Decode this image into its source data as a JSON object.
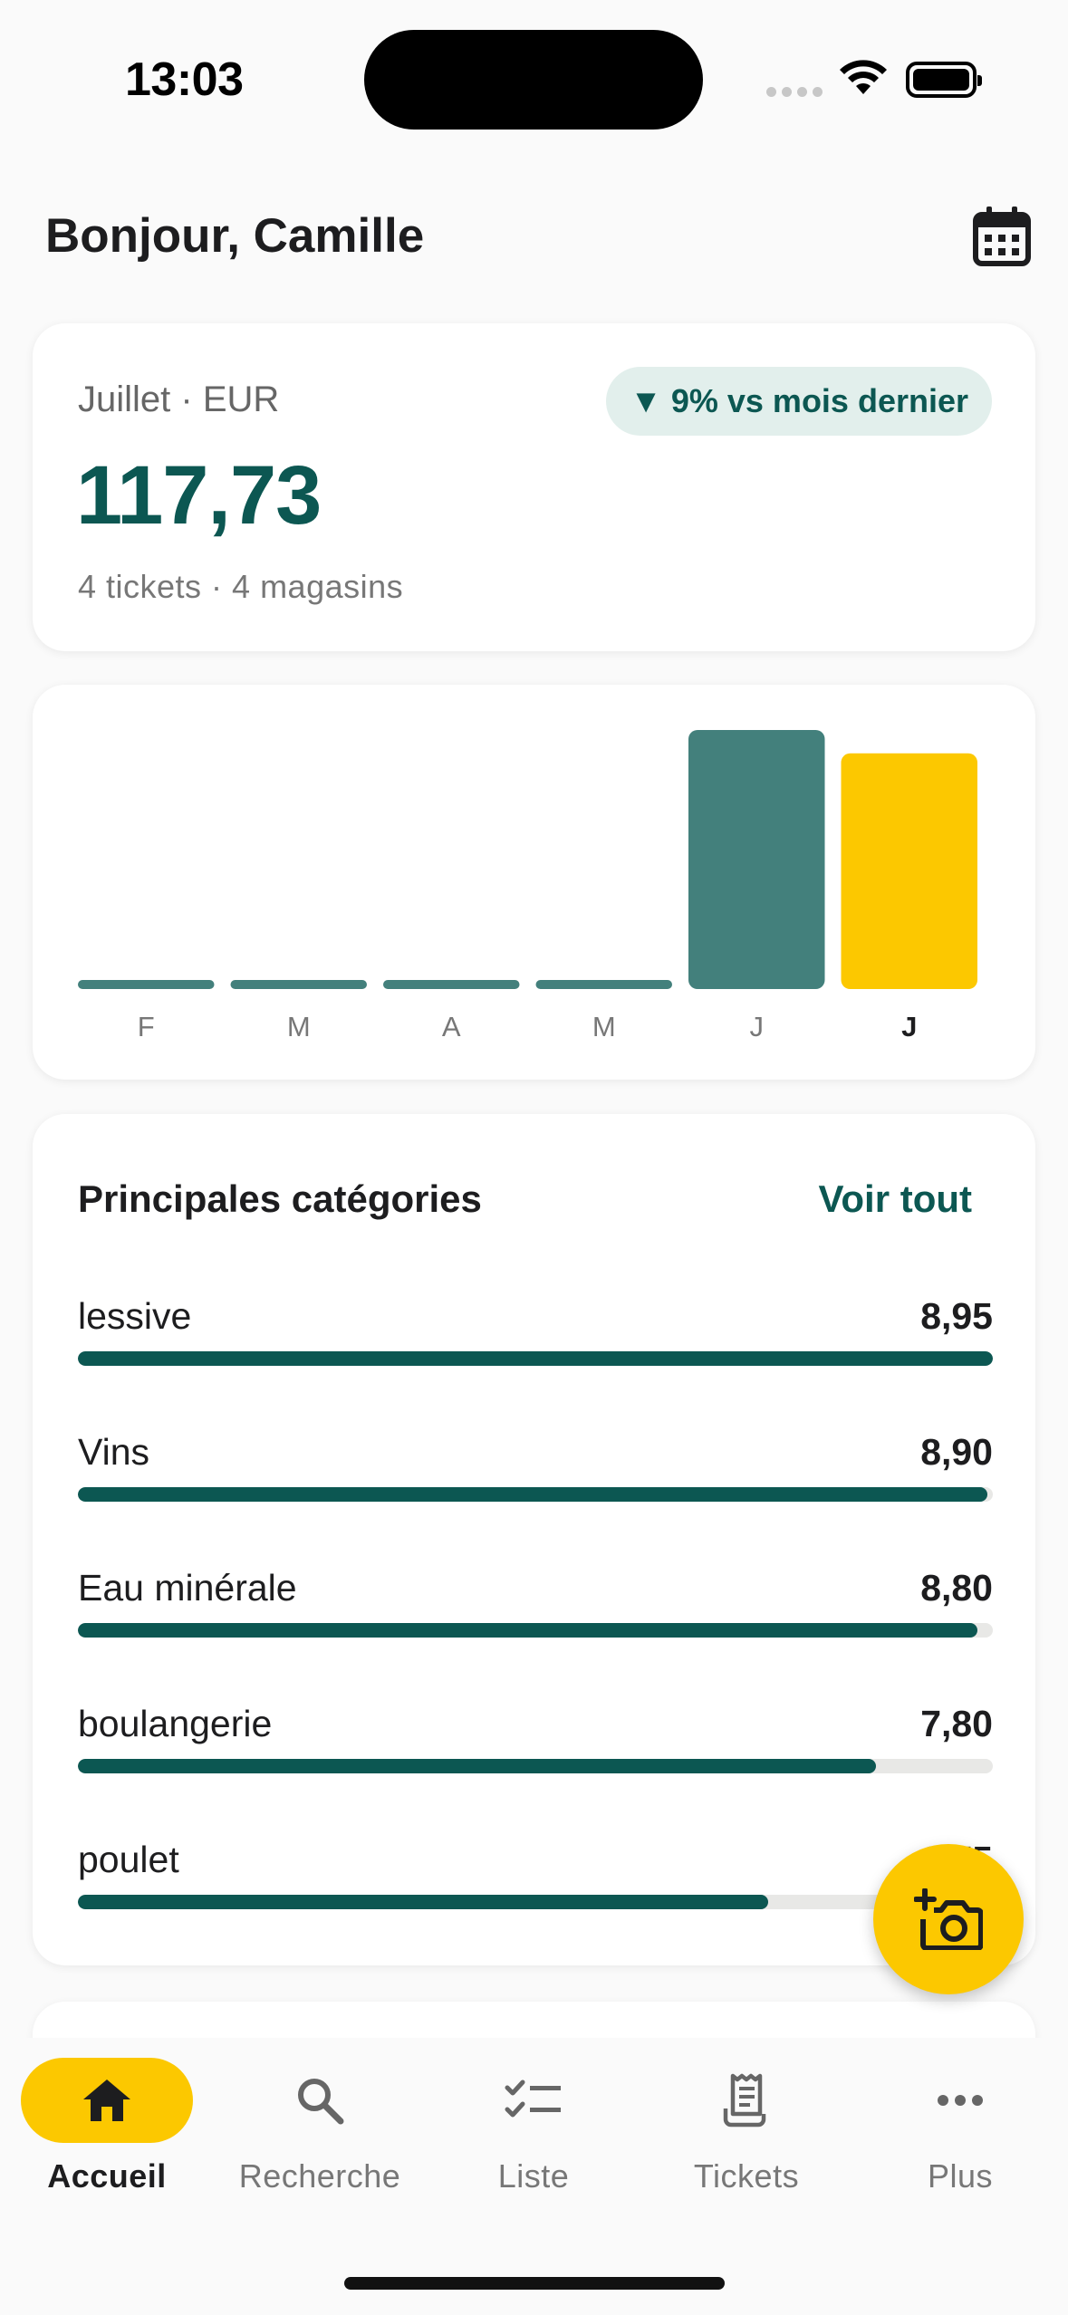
{
  "status_bar": {
    "time": "13:03"
  },
  "header": {
    "greeting": "Bonjour, Camille",
    "calendar_icon": "calendar-icon"
  },
  "summary": {
    "period_label": "Juillet · EUR",
    "delta_badge": "▼ 9% vs mois dernier",
    "total": "117,73",
    "subtitle": "4 tickets · 4 magasins"
  },
  "chart_data": {
    "type": "bar",
    "categories": [
      "F",
      "M",
      "A",
      "M",
      "J",
      "J"
    ],
    "values": [
      0,
      0,
      0,
      0,
      129.4,
      117.73
    ],
    "highlight_index": 5,
    "colors": {
      "bar": "#43807c",
      "highlight": "#fcc800"
    },
    "grid": false,
    "title": "",
    "xlabel": "",
    "ylabel": ""
  },
  "categories_card": {
    "title": "Principales catégories",
    "see_all": "Voir tout",
    "items": [
      {
        "name": "lessive",
        "value": "8,95",
        "ratio": 1.0
      },
      {
        "name": "Vins",
        "value": "8,90",
        "ratio": 0.994
      },
      {
        "name": "Eau minérale",
        "value": "8,80",
        "ratio": 0.983
      },
      {
        "name": "boulangerie",
        "value": "7,80",
        "ratio": 0.872
      },
      {
        "name": "poulet",
        "value": "6,75",
        "ratio": 0.754
      }
    ]
  },
  "fab": {
    "icon": "add-photo-camera-icon"
  },
  "nav": {
    "items": [
      {
        "label": "Accueil",
        "icon": "home-icon",
        "active": true
      },
      {
        "label": "Recherche",
        "icon": "search-icon",
        "active": false
      },
      {
        "label": "Liste",
        "icon": "checklist-icon",
        "active": false
      },
      {
        "label": "Tickets",
        "icon": "receipt-icon",
        "active": false
      },
      {
        "label": "Plus",
        "icon": "more-icon",
        "active": false
      }
    ]
  },
  "colors": {
    "primary": "#0c5752",
    "accent": "#fcc800",
    "bar": "#43807c",
    "badge_bg": "#e2efec"
  }
}
